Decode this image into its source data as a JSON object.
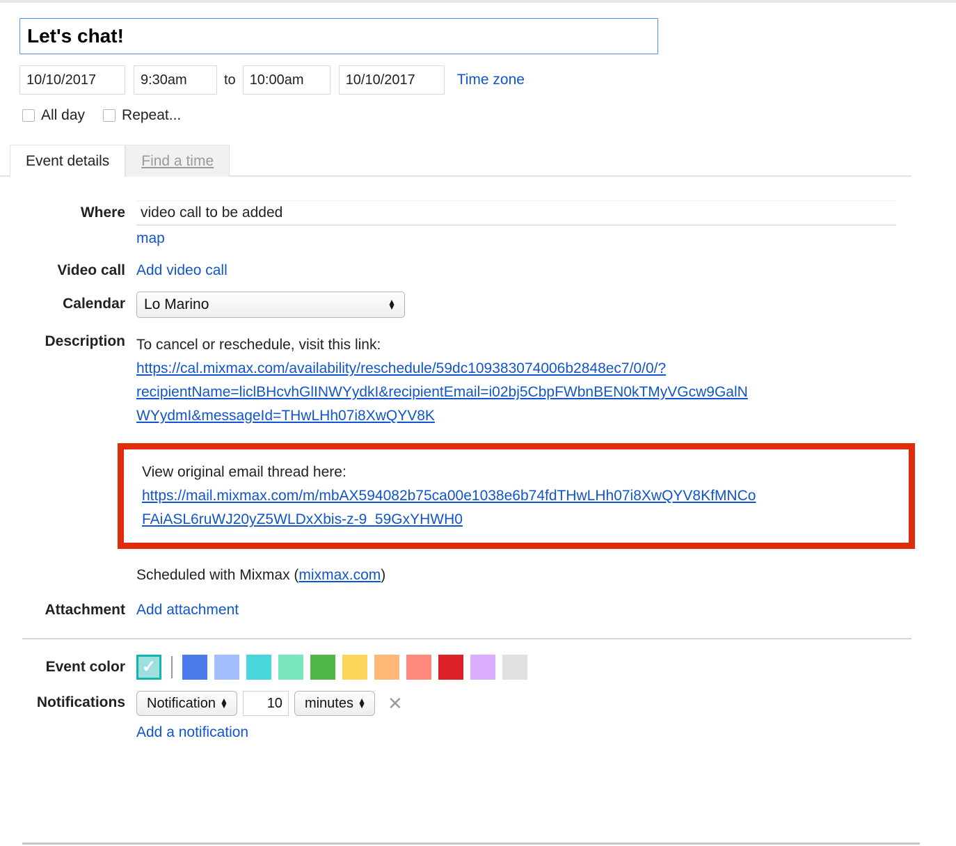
{
  "event": {
    "title": "Let's chat!",
    "start_date": "10/10/2017",
    "start_time": "9:30am",
    "to_label": "to",
    "end_time": "10:00am",
    "end_date": "10/10/2017",
    "timezone_link": "Time zone",
    "all_day_label": "All day",
    "repeat_label": "Repeat...",
    "all_day_checked": false,
    "repeat_checked": false
  },
  "tabs": [
    {
      "label": "Event details",
      "active": true
    },
    {
      "label": "Find a time",
      "active": false
    }
  ],
  "fields": {
    "where_label": "Where",
    "where_value": "video call to be added",
    "map_link": "map",
    "video_call_label": "Video call",
    "add_video_call_link": "Add video call",
    "calendar_label": "Calendar",
    "calendar_value": "Lo Marino",
    "description_label": "Description",
    "attachment_label": "Attachment",
    "add_attachment_link": "Add attachment",
    "event_color_label": "Event color",
    "notifications_label": "Notifications"
  },
  "description": {
    "intro": "To cancel or reschedule, visit this link:",
    "reschedule_url_line1": "https://cal.mixmax.com/availability/reschedule/59dc109383074006b2848ec7/0/0/?",
    "reschedule_url_line2": "recipientName=liclBHcvhGlINWYydkI&recipientEmail=i02bj5CbpFWbnBEN0kTMyVGcw9GalN",
    "reschedule_url_line3": "WYydmI&messageId=THwLHh07i8XwQYV8K",
    "thread_intro": "View original email thread here:",
    "thread_url_line1": "https://mail.mixmax.com/m/mbAX594082b75ca00e1038e6b74fdTHwLHh07i8XwQYV8KfMNCo",
    "thread_url_line2": "FAiASL6ruWJ20yZ5WLDxXbis-z-9_59GxYHWH0",
    "scheduled_prefix": "Scheduled with Mixmax (",
    "scheduled_link": "mixmax.com",
    "scheduled_suffix": ")"
  },
  "highlight": {
    "border_color": "#e02b0c"
  },
  "event_colors": {
    "selected_index": 0,
    "selected_border": "#12b5ab",
    "selected_fill": "#9ee0dd",
    "check_glyph": "✓",
    "swatches": [
      "#4c7ceb",
      "#a4bdfc",
      "#46d6db",
      "#7ae7bf",
      "#51b749",
      "#fbd75b",
      "#ffb878",
      "#ff887c",
      "#dc2127",
      "#dbadff",
      "#e1e1e1"
    ]
  },
  "notifications": {
    "type_value": "Notification",
    "amount_value": "10",
    "unit_value": "minutes",
    "remove_glyph": "✕",
    "add_link": "Add a notification"
  }
}
